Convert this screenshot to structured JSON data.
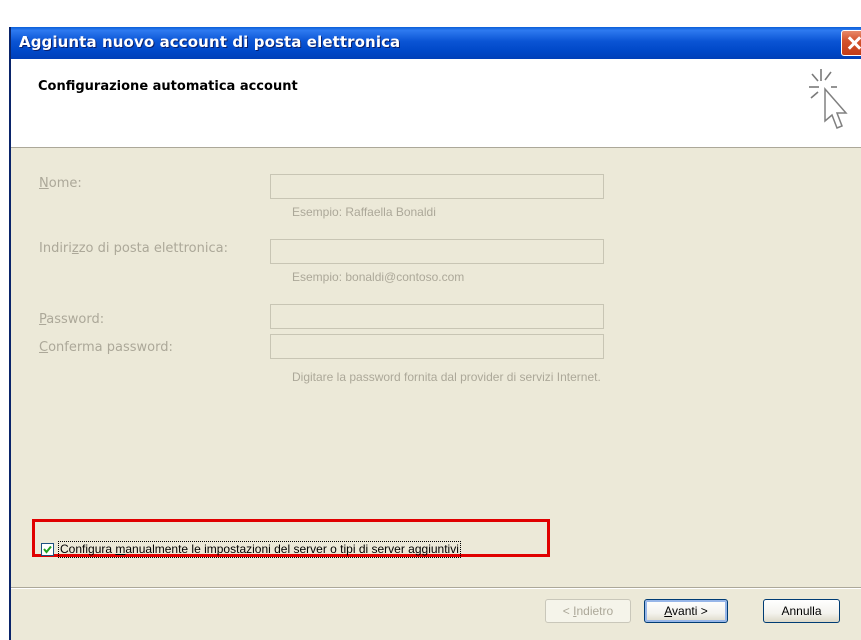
{
  "window": {
    "title": "Aggiunta nuovo account di posta elettronica"
  },
  "header": {
    "heading": "Configurazione automatica account",
    "icon": "wizard-cursor-sparkle-icon"
  },
  "form": {
    "name": {
      "label_pre": "",
      "label_ul": "N",
      "label_post": "ome:",
      "value": "",
      "hint": "Esempio: Raffaella Bonaldi"
    },
    "email": {
      "label_pre": "Indiri",
      "label_ul": "z",
      "label_post": "zo di posta elettronica:",
      "value": "",
      "hint": "Esempio: bonaldi@contoso.com"
    },
    "password": {
      "label_pre": "",
      "label_ul": "P",
      "label_post": "assword:",
      "value": ""
    },
    "confirm_password": {
      "label_pre": "",
      "label_ul": "C",
      "label_post": "onferma password:",
      "value": "",
      "hint": "Digitare la password fornita dal provider di servizi Internet."
    }
  },
  "manual_config": {
    "checked": true,
    "label_pre": "Configura ",
    "label_ul": "m",
    "label_post": "anualmente le impostazioni del server o tipi di server aggiuntivi"
  },
  "buttons": {
    "back": {
      "pre": "< ",
      "ul": "I",
      "post": "ndietro"
    },
    "next": {
      "pre": "",
      "ul": "A",
      "post": "vanti >"
    },
    "cancel": {
      "label": "Annulla"
    }
  },
  "colors": {
    "highlight": "#e00000",
    "titlebar": "#0054e3",
    "disabled_text": "#aca899"
  }
}
